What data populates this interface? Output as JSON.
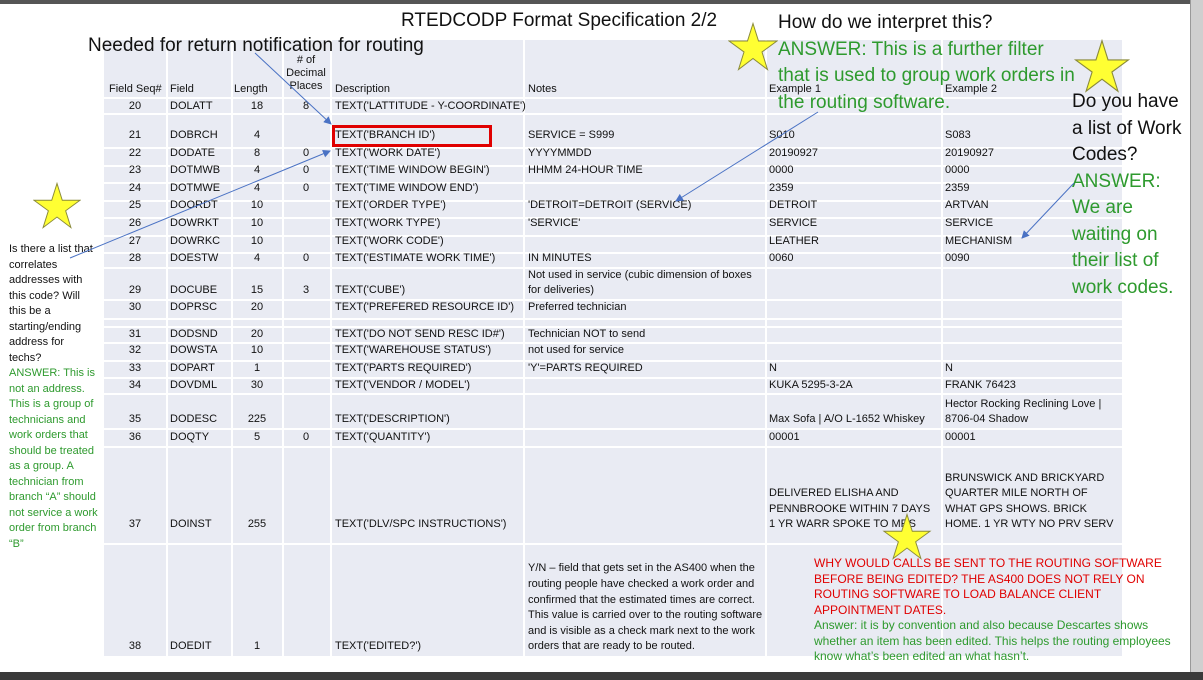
{
  "title": "RTEDCODP Format Specification 2/2",
  "annotations": {
    "routing_note": "Needed for return notification for routing",
    "interpret_question": "How do we interpret this?",
    "interpret_answer": "ANSWER: This is a further filter that is used to group work orders in the routing software.",
    "list_question": "Do you have a list of Work Codes?",
    "list_answer": "ANSWER: We are waiting on their list of work codes.",
    "left_question": "Is there a list that correlates addresses with this code? Will this be a starting/ending address for techs?",
    "left_answer": "ANSWER: This is not an address. This is a group of technicians and work orders that should be treated as a group. A technician from branch “A” should not service a work order from branch “B”",
    "bottom_question": "WHY WOULD CALLS BE SENT TO THE ROUTING SOFTWARE BEFORE BEING EDITED? THE AS400 DOES NOT RELY ON ROUTING SOFTWARE TO LOAD BALANCE CLIENT APPOINTMENT DATES.",
    "bottom_answer": "Answer: it is by convention and also because Descartes shows whether an item has been edited. This helps the routing employees know what’s been edited an what hasn’t."
  },
  "table": {
    "headers": {
      "seq": "Field Seq#",
      "field": "Field",
      "length": "Length",
      "decimal": "# of Decimal Places",
      "description": "Description",
      "notes": "Notes",
      "example1": "Example 1",
      "example2": "Example 2"
    },
    "rows": [
      {
        "seq": "20",
        "field": "DOLATT",
        "length": "18",
        "decimal": "8",
        "description": "TEXT('LATTITUDE - Y-COORDINATE')",
        "notes": "",
        "example1": "",
        "example2": ""
      },
      {
        "seq": "21",
        "field": "DOBRCH",
        "length": "4",
        "decimal": "",
        "description": "TEXT('BRANCH ID')",
        "notes": "SERVICE = S999",
        "example1": "S010",
        "example2": "S083"
      },
      {
        "seq": "22",
        "field": "DODATE",
        "length": "8",
        "decimal": "0",
        "description": "TEXT('WORK DATE')",
        "notes": "YYYYMMDD",
        "example1": "20190927",
        "example2": "20190927"
      },
      {
        "seq": "23",
        "field": "DOTMWB",
        "length": "4",
        "decimal": "0",
        "description": "TEXT('TIME WINDOW BEGIN')",
        "notes": "HHMM 24-HOUR TIME",
        "example1": "0000",
        "example2": "0000"
      },
      {
        "seq": "24",
        "field": "DOTMWE",
        "length": "4",
        "decimal": "0",
        "description": "TEXT('TIME WINDOW END')",
        "notes": "",
        "example1": "2359",
        "example2": "2359"
      },
      {
        "seq": "25",
        "field": "DOORDT",
        "length": "10",
        "decimal": "",
        "description": "TEXT('ORDER TYPE')",
        "notes": "'DETROIT=DETROIT (SERVICE)",
        "example1": "DETROIT",
        "example2": "ARTVAN"
      },
      {
        "seq": "26",
        "field": "DOWRKT",
        "length": "10",
        "decimal": "",
        "description": " TEXT('WORK TYPE')",
        "notes": "'SERVICE'",
        "example1": "SERVICE",
        "example2": "SERVICE"
      },
      {
        "seq": "27",
        "field": "DOWRKC",
        "length": "10",
        "decimal": "",
        "description": "TEXT('WORK CODE')",
        "notes": "",
        "example1": "LEATHER",
        "example2": "MECHANISM"
      },
      {
        "seq": "28",
        "field": "DOESTW",
        "length": "4",
        "decimal": "0",
        "description": "TEXT('ESTIMATE WORK TIME')",
        "notes": "IN MINUTES",
        "example1": "0060",
        "example2": "0090"
      },
      {
        "seq": "29",
        "field": "DOCUBE",
        "length": "15",
        "decimal": "3",
        "description": "TEXT('CUBE')",
        "notes": "Not used in service (cubic dimension of boxes for deliveries)",
        "example1": "",
        "example2": ""
      },
      {
        "seq": "30",
        "field": "DOPRSC",
        "length": "20",
        "decimal": "",
        "description": "TEXT('PREFERED RESOURCE ID')",
        "notes": "Preferred technician",
        "example1": "",
        "example2": ""
      },
      {
        "seq": "31",
        "field": "DODSND",
        "length": "20",
        "decimal": "",
        "description": "TEXT('DO NOT SEND RESC ID#')",
        "notes": "Technician NOT to send",
        "example1": "",
        "example2": ""
      },
      {
        "seq": "32",
        "field": "DOWSTA",
        "length": "10",
        "decimal": "",
        "description": "TEXT('WAREHOUSE STATUS')",
        "notes": "not used for service",
        "example1": "",
        "example2": ""
      },
      {
        "seq": "33",
        "field": "DOPART",
        "length": "1",
        "decimal": "",
        "description": "TEXT('PARTS REQUIRED')",
        "notes": "'Y'=PARTS REQUIRED",
        "example1": "N",
        "example2": "N"
      },
      {
        "seq": "34",
        "field": "DOVDML",
        "length": "30",
        "decimal": "",
        "description": "TEXT('VENDOR / MODEL')",
        "notes": "",
        "example1": "KUKA  5295-3-2A",
        "example2": "FRANK 76423"
      },
      {
        "seq": "35",
        "field": "DODESC",
        "length": "225",
        "decimal": "",
        "description": "TEXT('DESCRIPTION')",
        "notes": "",
        "example1": "Max Sofa | A/O L-1652 Whiskey",
        "example2": "Hector Rocking Reclining Love | 8706-04 Shadow"
      },
      {
        "seq": "36",
        "field": "DOQTY",
        "length": "5",
        "decimal": "0",
        "description": "TEXT('QUANTITY')",
        "notes": "",
        "example1": "00001",
        "example2": "00001"
      },
      {
        "seq": "37",
        "field": "DOINST",
        "length": "255",
        "decimal": "",
        "description": "TEXT('DLV/SPC INSTRUCTIONS')",
        "notes": "",
        "example1": "DELIVERED ELISHA AND PENNBROOKE WITHIN 7 DAYS 1 YR WARR SPOKE TO MRS",
        "example2": "BRUNSWICK AND BRICKYARD QUARTER MILE NORTH OF WHAT GPS SHOWS. BRICK HOME.                    1 YR WTY NO PRV SERV"
      },
      {
        "seq": "38",
        "field": "DOEDIT",
        "length": "1",
        "decimal": "",
        "description": "TEXT('EDITED?')",
        "notes": "Y/N – field that gets set in the AS400 when the routing people have checked a work order and confirmed that the estimated times are correct. This value is carried over to the routing software and is visible as a check mark next to the work orders that are ready to be routed.",
        "example1": "",
        "example2": ""
      }
    ]
  },
  "colors": {
    "table_bg": "#e9ebf3",
    "answer_green": "#2e9a2e",
    "alert_red": "#e00000",
    "star_fill": "#ffff33",
    "arrow_blue": "#4a72c4"
  }
}
